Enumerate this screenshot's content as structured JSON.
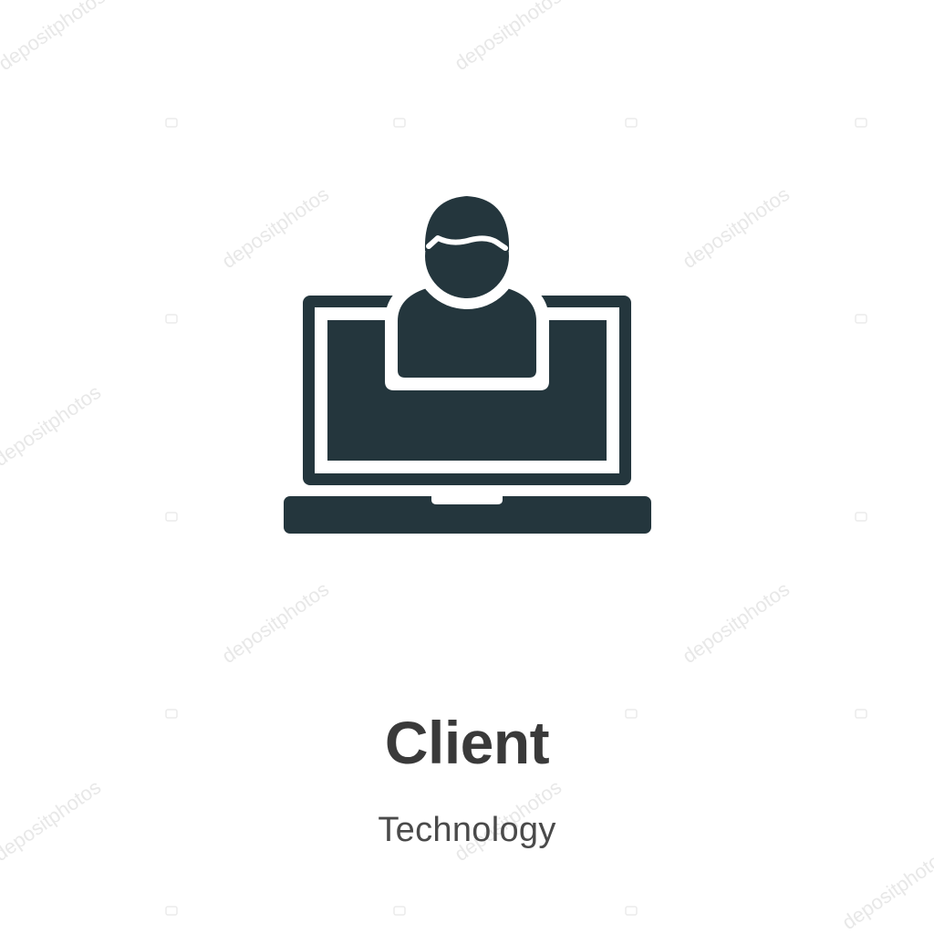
{
  "title": "Client",
  "category": "Technology",
  "watermark": "depositphotos",
  "colors": {
    "icon": "#24363d",
    "title": "#3a3a3a",
    "subtitle": "#4a4a4a",
    "background": "#ffffff",
    "watermark": "#e6e6e6"
  }
}
